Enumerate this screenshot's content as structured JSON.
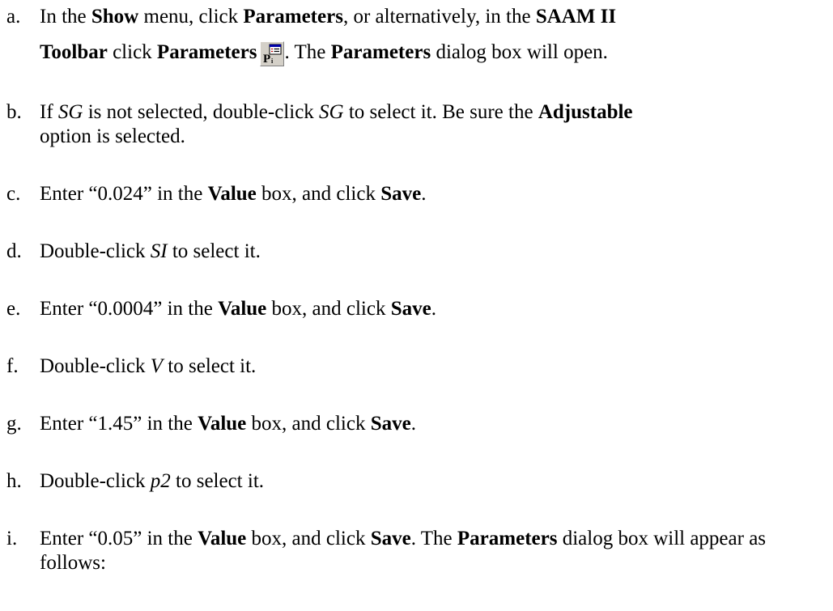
{
  "steps": {
    "a": {
      "letter": "a.",
      "t1": "In the ",
      "t2": "Show",
      "t3": " menu, click ",
      "t4": "Parameters",
      "t5": ", or alternatively, in the ",
      "t6": "SAAM II",
      "t7": "Toolbar",
      "t8": " click ",
      "t9": "Parameters",
      "t10": ". The ",
      "t11": "Parameters",
      "t12": " dialog box will open.",
      "icon": "parameters-toolbar-icon"
    },
    "b": {
      "letter": "b.",
      "t1": "If ",
      "t2": "SG",
      "t3": " is not selected, double-click ",
      "t4": "SG",
      "t5": "  to select it. Be sure the ",
      "t6": "Adjustable",
      "t7": " option is selected."
    },
    "c": {
      "letter": "c.",
      "t1": "Enter “0.024” in the ",
      "t2": "Value",
      "t3": " box, and click ",
      "t4": "Save",
      "t5": "."
    },
    "d": {
      "letter": "d.",
      "t1": "Double-click ",
      "t2": "SI",
      "t3": " to select it."
    },
    "e": {
      "letter": "e.",
      "t1": "Enter “0.0004” in the ",
      "t2": "Value",
      "t3": " box, and click ",
      "t4": "Save",
      "t5": "."
    },
    "f": {
      "letter": "f.",
      "t1": "Double-click ",
      "t2": "V",
      "t3": " to select it."
    },
    "g": {
      "letter": "g.",
      "t1": "Enter “1.45” in the ",
      "t2": "Value",
      "t3": " box, and click ",
      "t4": "Save",
      "t5": "."
    },
    "h": {
      "letter": "h.",
      "t1": "Double-click ",
      "t2": "p2",
      "t3": " to select it."
    },
    "i": {
      "letter": "i.",
      "t1": "Enter “0.05” in the ",
      "t2": "Value",
      "t3": " box, and click ",
      "t4": "Save",
      "t5": ". The ",
      "t6": "Parameters",
      "t7": " dialog box will appear as follows:"
    }
  },
  "colors": {
    "icon_face": "#d4d0c8",
    "icon_blue": "#0000a8",
    "icon_red": "#c00000"
  }
}
